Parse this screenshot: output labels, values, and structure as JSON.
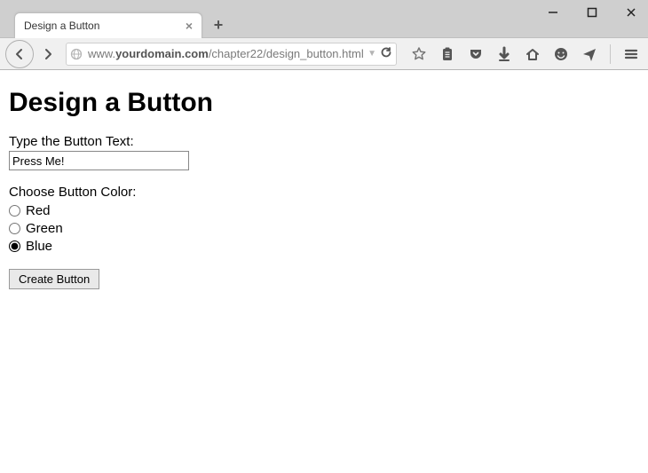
{
  "window": {
    "tab_title": "Design a Button"
  },
  "url": {
    "prefix": "www.",
    "domain": "yourdomain.com",
    "path": "/chapter22/design_button.html"
  },
  "page": {
    "heading": "Design a Button",
    "text_label": "Type the Button Text:",
    "text_value": "Press Me!",
    "color_label": "Choose Button Color:",
    "colors": [
      {
        "label": "Red",
        "checked": false
      },
      {
        "label": "Green",
        "checked": false
      },
      {
        "label": "Blue",
        "checked": true
      }
    ],
    "submit_label": "Create Button"
  }
}
